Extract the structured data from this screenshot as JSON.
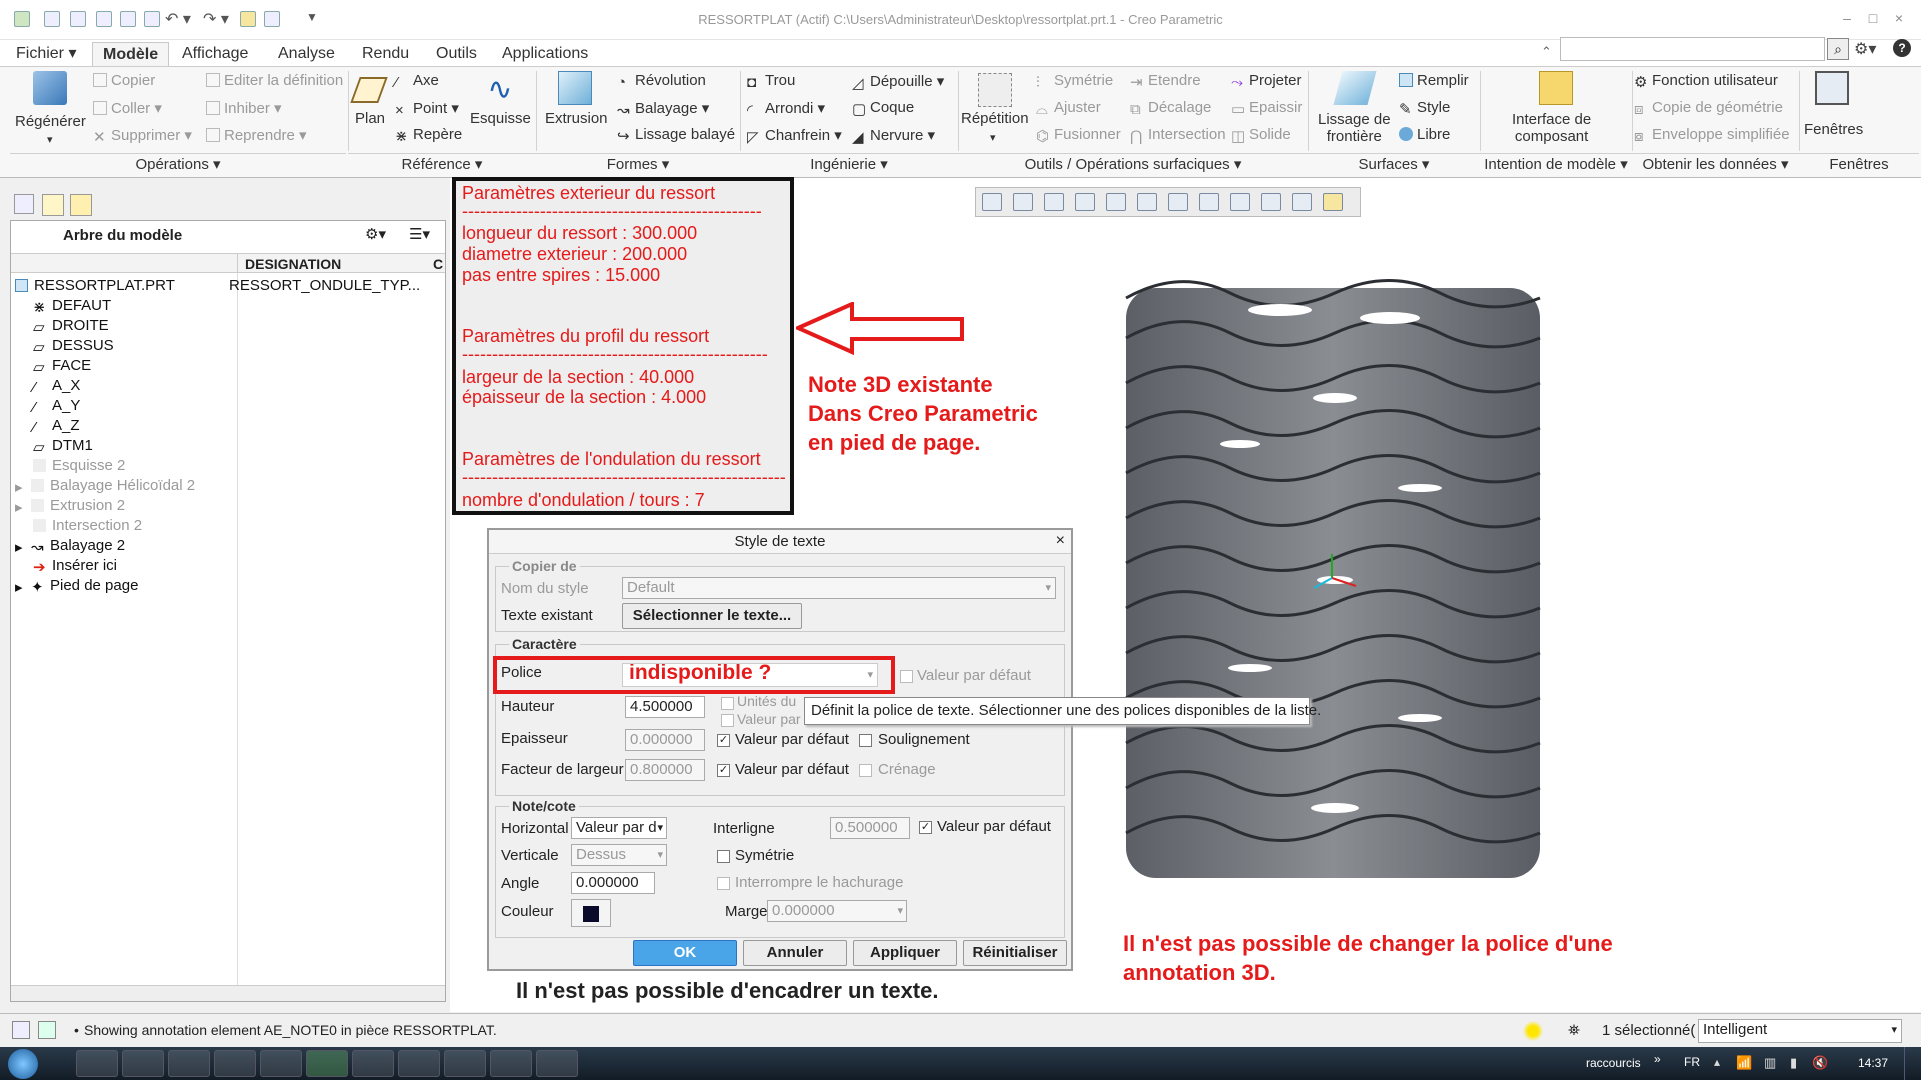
{
  "window": {
    "title": "RESSORTPLAT (Actif) C:\\Users\\Administrateur\\Desktop\\ressortplat.prt.1 - Creo Parametric",
    "min": "–",
    "max": "□",
    "close": "×"
  },
  "tabs": [
    "Fichier",
    "Modèle",
    "Affichage",
    "Analyse",
    "Rendu",
    "Outils",
    "Applications"
  ],
  "ribbon": {
    "regenerer": "Régénérer",
    "copier": "Copier",
    "coller": "Coller",
    "supprimer": "Supprimer",
    "editer_definition": "Editer la définition",
    "inhiber": "Inhiber",
    "reprendre": "Reprendre",
    "plan": "Plan",
    "axe": "Axe",
    "point": "Point",
    "repere": "Repère",
    "esquisse": "Esquisse",
    "extrusion": "Extrusion",
    "revolution": "Révolution",
    "balayage": "Balayage",
    "lissage_balaye": "Lissage balayé",
    "trou": "Trou",
    "arrondi": "Arrondi",
    "chanfrein": "Chanfrein",
    "depouille": "Dépouille",
    "coque": "Coque",
    "nervure": "Nervure",
    "repetition": "Répétition",
    "symetrie": "Symétrie",
    "ajuster": "Ajuster",
    "fusionner": "Fusionner",
    "etendre": "Etendre",
    "decalage": "Décalage",
    "intersection": "Intersection",
    "projeter": "Projeter",
    "epaissir": "Epaissir",
    "solide": "Solide",
    "lissage_frontiere_1": "Lissage de",
    "lissage_frontiere_2": "frontière",
    "remplir": "Remplir",
    "style": "Style",
    "libre": "Libre",
    "interface_1": "Interface de",
    "interface_2": "composant",
    "fonction_utilisateur": "Fonction utilisateur",
    "copie_geometrie": "Copie de géométrie",
    "enveloppe": "Enveloppe simplifiée",
    "fenetres": "Fenêtres"
  },
  "groups": [
    "Opérations",
    "Référence",
    "Formes",
    "Ingénierie",
    "Outils / Opérations surfaciques",
    "Surfaces",
    "Intention de modèle",
    "Obtenir les données",
    "Fenêtres"
  ],
  "tree": {
    "title": "Arbre du modèle",
    "col_designation": "DESIGNATION",
    "col_c": "C",
    "root": "RESSORTPLAT.PRT",
    "root_designation": "RESSORT_ONDULE_TYP...",
    "items": [
      {
        "label": "DEFAUT",
        "dim": false
      },
      {
        "label": "DROITE",
        "dim": false
      },
      {
        "label": "DESSUS",
        "dim": false
      },
      {
        "label": "FACE",
        "dim": false
      },
      {
        "label": "A_X",
        "dim": false
      },
      {
        "label": "A_Y",
        "dim": false
      },
      {
        "label": "A_Z",
        "dim": false
      },
      {
        "label": "DTM1",
        "dim": false
      },
      {
        "label": "Esquisse 2",
        "dim": true
      },
      {
        "label": "Balayage Hélicoïdal 2",
        "dim": true
      },
      {
        "label": "Extrusion 2",
        "dim": true
      },
      {
        "label": "Intersection 2",
        "dim": true
      },
      {
        "label": "Balayage 2",
        "dim": false
      },
      {
        "label": "Insérer ici",
        "dim": false
      },
      {
        "label": "Pied de page",
        "dim": false
      }
    ]
  },
  "note": {
    "l1": "Paramètres exterieur du ressort",
    "d1": "--------------------------------------------------",
    "l2": "longueur du ressort  :  300.000",
    "l3": "diametre exterieur  :  200.000",
    "l4": "pas entre spires  :  15.000",
    "l5": "Paramètres du profil du ressort",
    "d2": "---------------------------------------------------",
    "l6": "largeur de la section  :  40.000",
    "l7": "épaisseur de la section :  4.000",
    "l8": "Paramètres de l'ondulation du ressort",
    "d3": "------------------------------------------------------",
    "l9": "nombre d'ondulation / tours :  7"
  },
  "annotations": {
    "note3d_1": "Note 3D existante",
    "note3d_2": "Dans Creo Parametric",
    "note3d_3": "en pied de page.",
    "police_1": "Il n'est pas possible de changer la police d'une",
    "police_2": "annotation 3D.",
    "encadrer": "Il n'est pas possible d'encadrer un texte.",
    "indisponible": "indisponible ?"
  },
  "dialog": {
    "title": "Style de texte",
    "copier_de": "Copier de",
    "nom_style_label": "Nom du style",
    "nom_style_value": "Default",
    "texte_existant_label": "Texte existant",
    "selectionner_texte": "Sélectionner le texte...",
    "caractere": "Caractère",
    "police_label": "Police",
    "valeur_defaut": "Valeur par défaut",
    "hauteur_label": "Hauteur",
    "hauteur_value": "4.500000",
    "unites_du": "Unités du",
    "valeur_par": "Valeur par",
    "epaisseur_label": "Epaisseur",
    "epaisseur_value": "0.000000",
    "soulignement": "Soulignement",
    "facteur_label": "Facteur de largeur",
    "facteur_value": "0.800000",
    "crenage": "Crénage",
    "note_cote": "Note/cote",
    "horizontal_label": "Horizontal",
    "horizontal_value": "Valeur par d",
    "interligne_label": "Interligne",
    "interligne_value": "0.500000",
    "verticale_label": "Verticale",
    "verticale_value": "Dessus",
    "symetrie": "Symétrie",
    "angle_label": "Angle",
    "angle_value": "0.000000",
    "interrompre": "Interrompre le hachurage",
    "couleur_label": "Couleur",
    "marge_label": "Marge",
    "marge_value": "0.000000",
    "ok": "OK",
    "annuler": "Annuler",
    "appliquer": "Appliquer",
    "reinitialiser": "Réinitialiser"
  },
  "tooltip": "Définit la police de texte. Sélectionner une des polices disponibles de la liste.",
  "status": {
    "message": "Showing annotation element AE_NOTE0 in pièce RESSORTPLAT.",
    "selected": "1 sélectionné(",
    "filter": "Intelligent"
  },
  "taskbar": {
    "raccourcis": "raccourcis",
    "lang": "FR",
    "time": "14:37"
  },
  "colors": {
    "annotation_red": "#e51a1a",
    "spring_gray": "#7d8186",
    "dialog_bg": "#f0f0f0"
  }
}
